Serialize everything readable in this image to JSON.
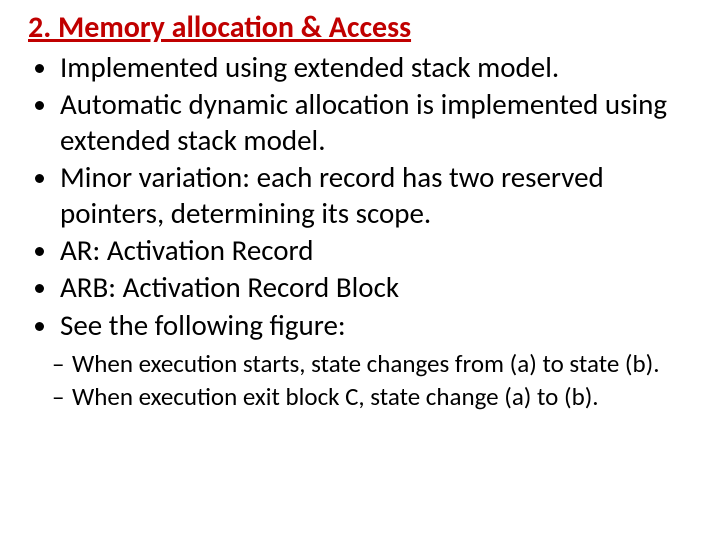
{
  "title": "2. Memory allocation & Access",
  "bullets": [
    "Implemented using extended stack model.",
    "Automatic dynamic allocation is implemented using extended stack model.",
    "Minor variation: each record has two reserved pointers, determining its scope.",
    "AR: Activation Record",
    "ARB: Activation Record Block",
    "See the following figure:"
  ],
  "sub_bullets": [
    "When execution starts, state changes from (a) to state (b).",
    "When execution exit block C, state change (a) to (b)."
  ]
}
